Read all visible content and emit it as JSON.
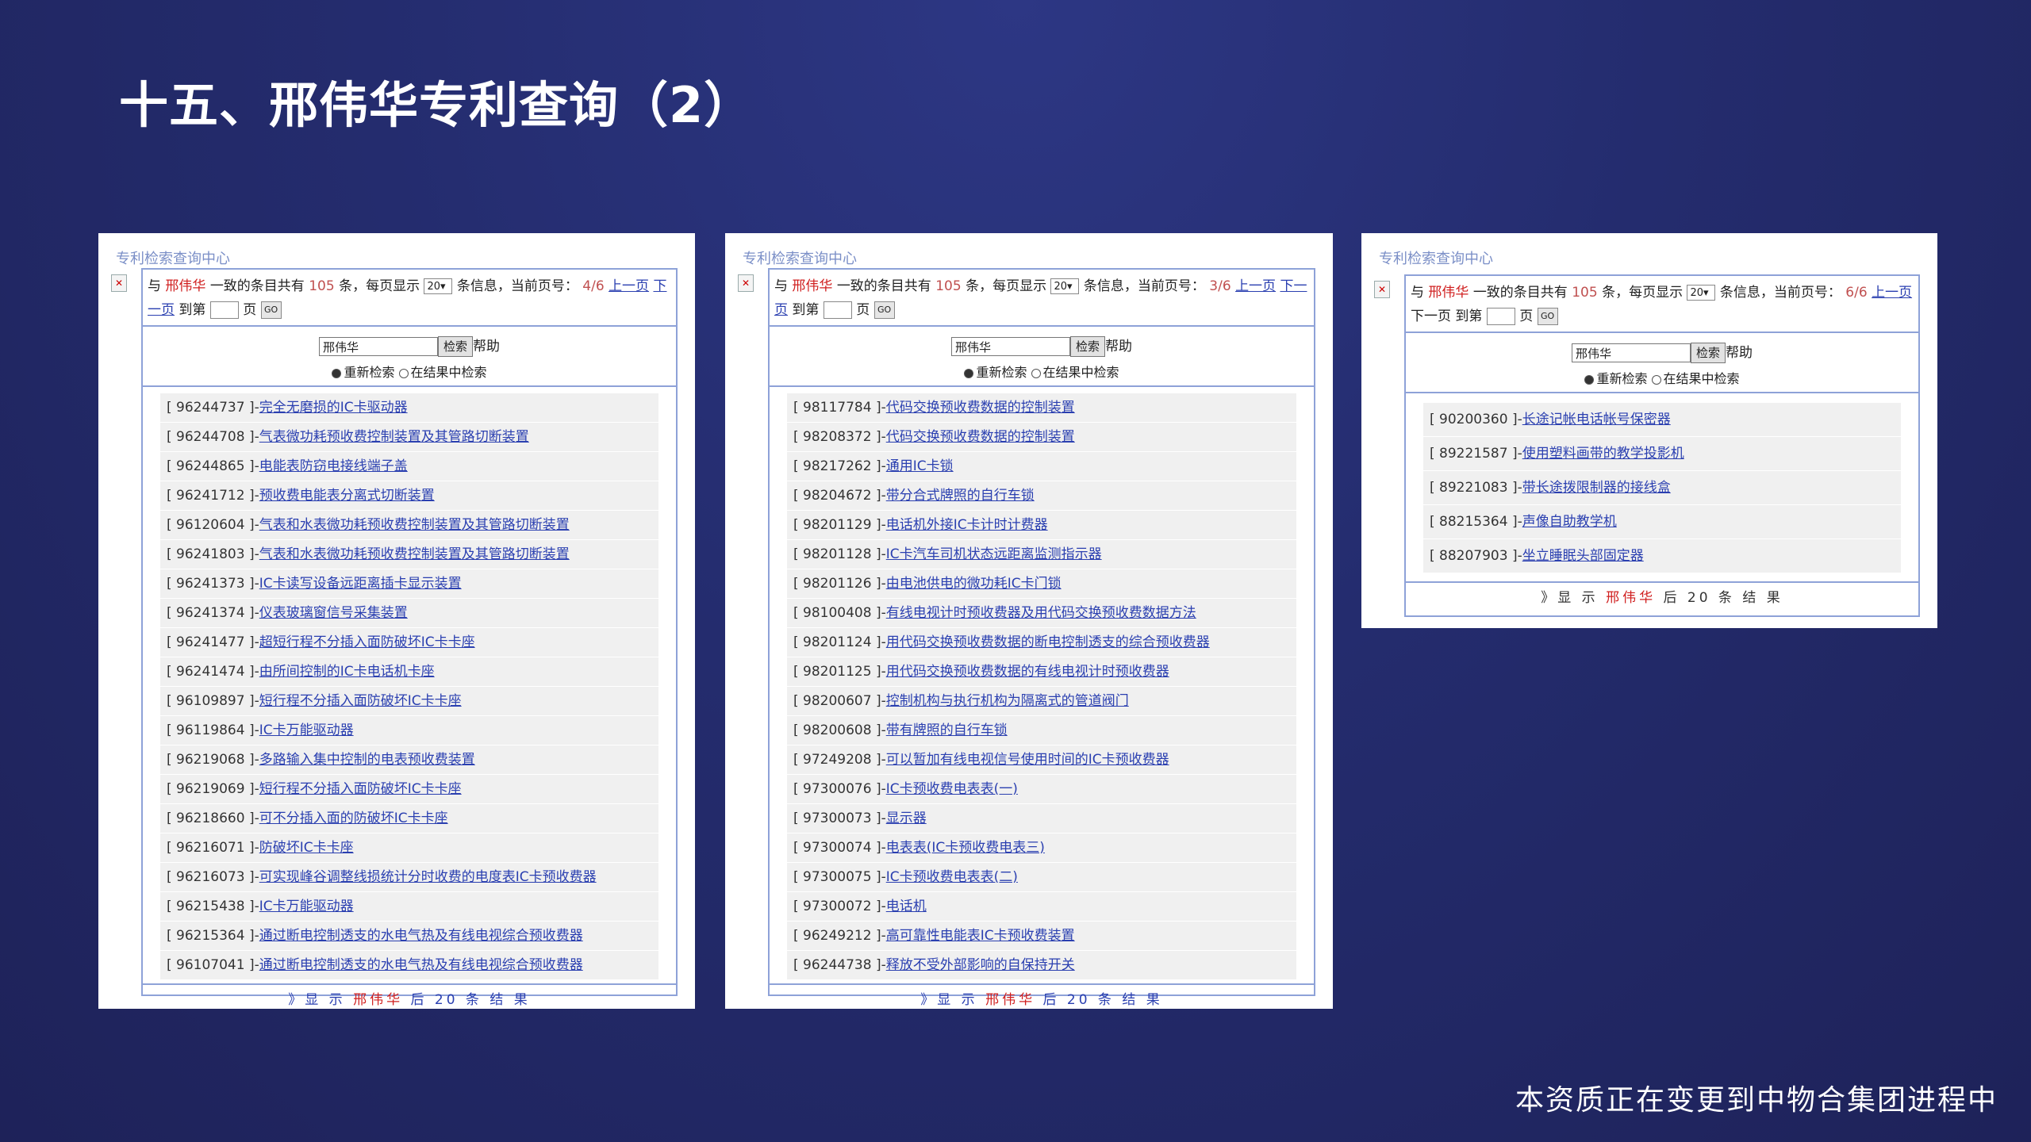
{
  "slide": {
    "title": "十五、邢伟华专利查询（2）",
    "footer": "本资质正在变更到中物合集团进程中"
  },
  "common": {
    "brand": "专利检索查询中心",
    "with": "与",
    "keyword": "邢伟华",
    "count_prefix": "一致的条目共有",
    "total": "105",
    "count_suffix": "条，每页显示",
    "per_page": "20",
    "info_suffix": "条信息，当前页号：",
    "prev": "上一页",
    "next": "下一页",
    "jump_label": "到第",
    "page_word": "页",
    "go": "GO",
    "search_value": "邢伟华",
    "search_btn": "检索",
    "help": "帮助",
    "radio_new": "重新检索",
    "radio_within": "在结果中检索",
    "more_prefix": "》显 示",
    "more_suffix": "后 20 条 结 果"
  },
  "panels": [
    {
      "page": "4/6",
      "rows": [
        {
          "id": "[ 96244737 ]-",
          "title": "完全无磨损的IC卡驱动器"
        },
        {
          "id": "[ 96244708 ]-",
          "title": "气表微功耗预收费控制装置及其管路切断装置"
        },
        {
          "id": "[ 96244865 ]-",
          "title": "电能表防窃电接线端子盖"
        },
        {
          "id": "[ 96241712 ]-",
          "title": "预收费电能表分离式切断装置"
        },
        {
          "id": "[ 96120604 ]-",
          "title": "气表和水表微功耗预收费控制装置及其管路切断装置"
        },
        {
          "id": "[ 96241803 ]-",
          "title": "气表和水表微功耗预收费控制装置及其管路切断装置"
        },
        {
          "id": "[ 96241373 ]-",
          "title": "IC卡读写设备远距离插卡显示装置"
        },
        {
          "id": "[ 96241374 ]-",
          "title": "仪表玻璃窗信号采集装置"
        },
        {
          "id": "[ 96241477 ]-",
          "title": "超短行程不分插入面防破坏IC卡卡座"
        },
        {
          "id": "[ 96241474 ]-",
          "title": "由所间控制的IC卡电话机卡座"
        },
        {
          "id": "[ 96109897 ]-",
          "title": "短行程不分插入面防破坏IC卡卡座"
        },
        {
          "id": "[ 96119864 ]-",
          "title": "IC卡万能驱动器"
        },
        {
          "id": "[ 96219068 ]-",
          "title": "多路输入集中控制的电表预收费装置"
        },
        {
          "id": "[ 96219069 ]-",
          "title": "短行程不分插入面防破坏IC卡卡座"
        },
        {
          "id": "[ 96218660 ]-",
          "title": "可不分插入面的防破坏IC卡卡座"
        },
        {
          "id": "[ 96216071 ]-",
          "title": "防破坏IC卡卡座"
        },
        {
          "id": "[ 96216073 ]-",
          "title": "可实现峰谷调整线损统计分时收费的电度表IC卡预收费器"
        },
        {
          "id": "[ 96215438 ]-",
          "title": "IC卡万能驱动器"
        },
        {
          "id": "[ 96215364 ]-",
          "title": "通过断电控制透支的水电气热及有线电视综合预收费器"
        },
        {
          "id": "[ 96107041 ]-",
          "title": "通过断电控制透支的水电气热及有线电视综合预收费器"
        }
      ]
    },
    {
      "page": "3/6",
      "rows": [
        {
          "id": "[ 98117784 ]-",
          "title": "代码交换预收费数据的控制装置"
        },
        {
          "id": "[ 98208372 ]-",
          "title": "代码交换预收费数据的控制装置"
        },
        {
          "id": "[ 98217262 ]-",
          "title": "通用IC卡锁"
        },
        {
          "id": "[ 98204672 ]-",
          "title": "带分合式牌照的自行车锁"
        },
        {
          "id": "[ 98201129 ]-",
          "title": "电话机外接IC卡计时计费器"
        },
        {
          "id": "[ 98201128 ]-",
          "title": "IC卡汽车司机状态远距离监测指示器"
        },
        {
          "id": "[ 98201126 ]-",
          "title": "由电池供电的微功耗IC卡门锁"
        },
        {
          "id": "[ 98100408 ]-",
          "title": "有线电视计时预收费器及用代码交换预收费数据方法"
        },
        {
          "id": "[ 98201124 ]-",
          "title": "用代码交换预收费数据的断电控制透支的综合预收费器"
        },
        {
          "id": "[ 98201125 ]-",
          "title": "用代码交换预收费数据的有线电视计时预收费器"
        },
        {
          "id": "[ 98200607 ]-",
          "title": "控制机构与执行机构为隔离式的管道阀门"
        },
        {
          "id": "[ 98200608 ]-",
          "title": "带有牌照的自行车锁"
        },
        {
          "id": "[ 97249208 ]-",
          "title": "可以暂加有线电视信号使用时间的IC卡预收费器"
        },
        {
          "id": "[ 97300076 ]-",
          "title": "IC卡预收费电表表(一)"
        },
        {
          "id": "[ 97300073 ]-",
          "title": "显示器"
        },
        {
          "id": "[ 97300074 ]-",
          "title": "电表表(IC卡预收费电表三)"
        },
        {
          "id": "[ 97300075 ]-",
          "title": "IC卡预收费电表表(二)"
        },
        {
          "id": "[ 97300072 ]-",
          "title": "电话机"
        },
        {
          "id": "[ 96249212 ]-",
          "title": "高可靠性电能表IC卡预收费装置"
        },
        {
          "id": "[ 96244738 ]-",
          "title": "释放不受外部影响的自保持开关"
        }
      ]
    },
    {
      "page": "6/6",
      "rows": [
        {
          "id": "[ 90200360 ]-",
          "title": "长途记帐电话帐号保密器"
        },
        {
          "id": "[ 89221587 ]-",
          "title": "使用塑料画带的教学投影机"
        },
        {
          "id": "[ 89221083 ]-",
          "title": "带长途拨限制器的接线盒"
        },
        {
          "id": "[ 88215364 ]-",
          "title": "声像自助教学机"
        },
        {
          "id": "[ 88207903 ]-",
          "title": "坐立睡眠头部固定器"
        }
      ]
    }
  ]
}
